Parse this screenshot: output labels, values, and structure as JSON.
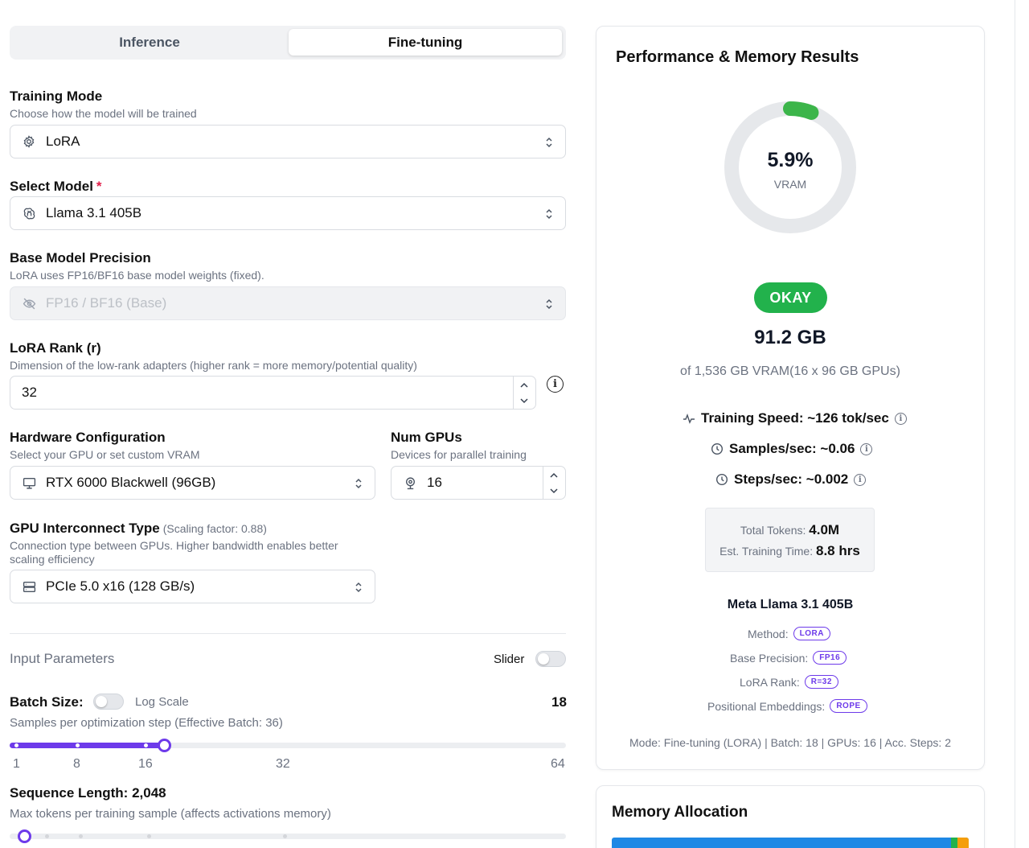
{
  "tabs": {
    "inference": "Inference",
    "finetuning": "Fine-tuning"
  },
  "training_mode": {
    "label": "Training Mode",
    "desc": "Choose how the model will be trained",
    "value": "LoRA"
  },
  "select_model": {
    "label": "Select Model",
    "required": "*",
    "value": "Llama 3.1 405B"
  },
  "precision": {
    "label": "Base Model Precision",
    "desc": "LoRA uses FP16/BF16 base model weights (fixed).",
    "value": "FP16 / BF16 (Base)"
  },
  "lora_rank": {
    "label": "LoRA Rank (r)",
    "desc": "Dimension of the low-rank adapters (higher rank = more memory/potential quality)",
    "value": "32"
  },
  "hardware": {
    "label": "Hardware Configuration",
    "desc": "Select your GPU or set custom VRAM",
    "value": "RTX 6000 Blackwell (96GB)"
  },
  "num_gpus": {
    "label": "Num GPUs",
    "desc": "Devices for parallel training",
    "value": "16"
  },
  "interconnect": {
    "label": "GPU Interconnect Type",
    "scaling": "(Scaling factor: 0.88)",
    "desc1": "Connection type between GPUs. Higher bandwidth enables better",
    "desc2": "scaling efficiency",
    "value": "PCIe 5.0 x16 (128 GB/s)"
  },
  "input_params": {
    "title": "Input Parameters",
    "slider_label": "Slider",
    "slider_on": false
  },
  "batch": {
    "label": "Batch Size:",
    "log_scale": "Log Scale",
    "log_on": false,
    "value": "18",
    "desc": "Samples per optimization step (Effective Batch: 36)",
    "ticks": [
      "1",
      "8",
      "16",
      "32",
      "64"
    ],
    "fraction": 0.277
  },
  "seq": {
    "label": "Sequence Length: 2,048",
    "desc": "Max tokens per training sample (affects activations memory)",
    "fraction": 0.02
  },
  "results": {
    "title": "Performance & Memory Results",
    "gauge_percent": "5.9%",
    "gauge_value": 0.059,
    "gauge_label": "VRAM",
    "status": "OKAY",
    "memory": "91.2 GB",
    "memory_of": "of 1,536 GB VRAM(16 x 96 GB GPUs)",
    "training_speed": "Training Speed: ~126 tok/sec",
    "samples_sec": "Samples/sec: ~0.06",
    "steps_sec": "Steps/sec: ~0.002",
    "total_tokens_label": "Total Tokens:",
    "total_tokens": "4.0M",
    "train_time_label": "Est. Training Time:",
    "train_time": "8.8 hrs",
    "model_name": "Meta Llama 3.1 405B",
    "method_label": "Method:",
    "method": "LORA",
    "base_precision_label": "Base Precision:",
    "base_precision": "FP16",
    "lora_rank_label": "LoRA Rank:",
    "lora_rank": "R=32",
    "pos_emb_label": "Positional Embeddings:",
    "pos_emb": "ROPE",
    "footer": "Mode: Fine-tuning (LORA) | Batch: 18 | GPUs: 16 | Acc. Steps: 2"
  },
  "memory_allocation": {
    "title": "Memory Allocation"
  },
  "colors": {
    "accent": "#6d3aea",
    "ok": "#22b24c",
    "gauge_fill": "#3cb54a",
    "gauge_track": "#e6e8eb",
    "bar": "#1e88e5"
  }
}
